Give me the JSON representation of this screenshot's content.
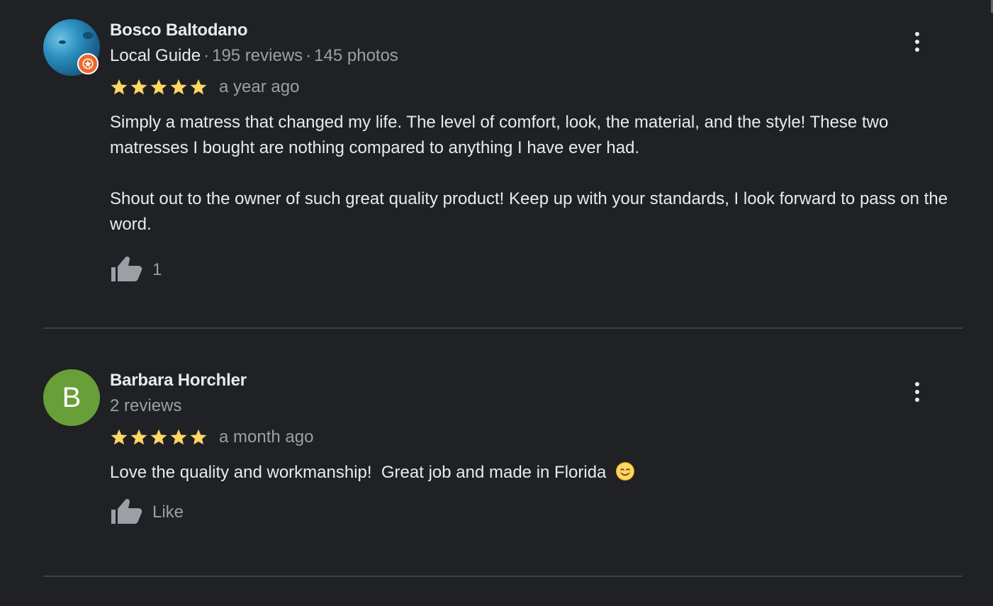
{
  "colors": {
    "background": "#202124",
    "text_primary": "#e8eaed",
    "text_secondary": "#9aa0a6",
    "star": "#fdd663",
    "divider": "#3c4043",
    "local_guide_badge": "#ea6a2a",
    "avatar_letter_bg": "#689f38"
  },
  "reviews": [
    {
      "author": "Bosco Baltodano",
      "is_local_guide": true,
      "local_guide_label": "Local Guide",
      "reviews_count": "195 reviews",
      "photos_count": "145 photos",
      "separator": "·",
      "rating": 5,
      "time": "a year ago",
      "text": "Simply a matress that changed my life. The level of comfort, look, the material, and the style! These two matresses I bought are nothing compared to anything I have ever had.\n\nShout out to the owner of such great quality product! Keep up with your standards, I look forward to pass on the word.",
      "like_label": "1",
      "icons": {
        "like": "thumbs-up-icon",
        "menu": "more-vert-icon",
        "badge": "local-guide-star-icon"
      }
    },
    {
      "author": "Barbara Horchler",
      "avatar_letter": "B",
      "reviews_count": "2 reviews",
      "rating": 5,
      "time": "a month ago",
      "text": "Love the quality and workmanship!  Great job and made in Florida",
      "emoji": "😊",
      "like_label": "Like",
      "icons": {
        "like": "thumbs-up-icon",
        "menu": "more-vert-icon"
      }
    }
  ]
}
